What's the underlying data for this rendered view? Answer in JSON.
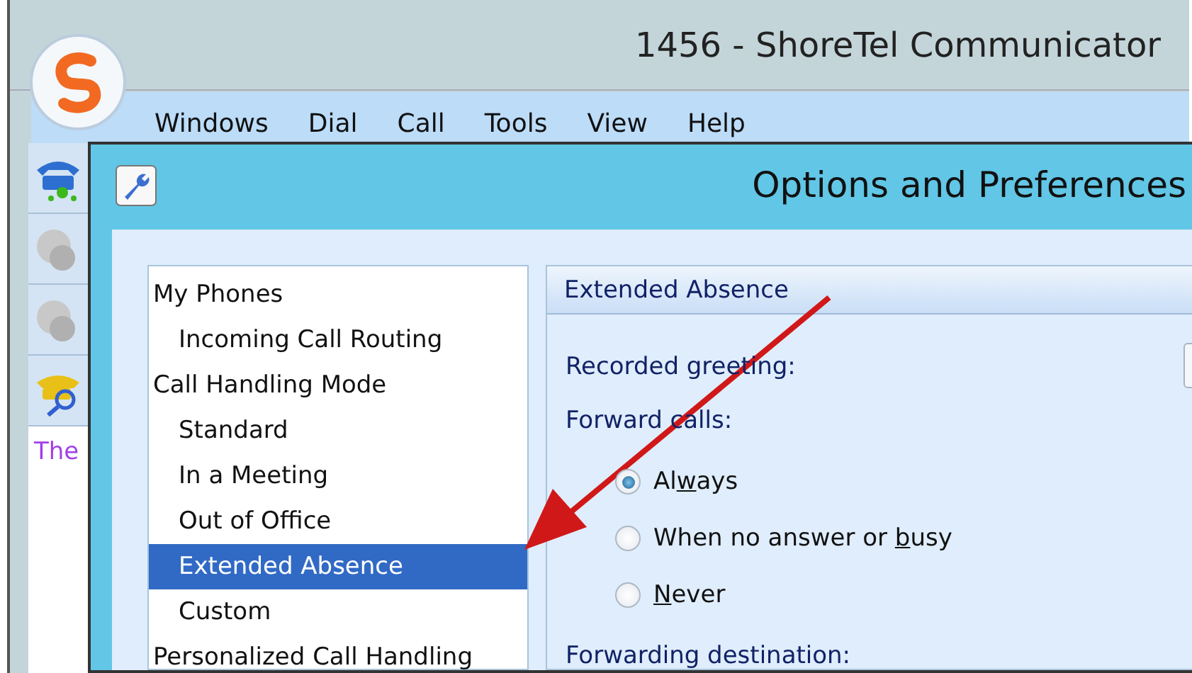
{
  "main_window": {
    "title": "1456 - ShoreTel Communicator",
    "menu": [
      "Windows",
      "Dial",
      "Call",
      "Tools",
      "View",
      "Help"
    ],
    "sidebar_text": "The"
  },
  "dialog": {
    "title": "Options and Preferences",
    "tree": [
      {
        "label": "My Phones",
        "selected": false,
        "children": [
          {
            "label": "Incoming Call Routing",
            "selected": false
          }
        ]
      },
      {
        "label": "Call Handling Mode",
        "selected": false,
        "children": [
          {
            "label": "Standard",
            "selected": false
          },
          {
            "label": "In a Meeting",
            "selected": false
          },
          {
            "label": "Out of Office",
            "selected": false
          },
          {
            "label": "Extended Absence",
            "selected": true
          },
          {
            "label": "Custom",
            "selected": false
          }
        ]
      },
      {
        "label": "Personalized Call Handling",
        "selected": false
      }
    ],
    "panel": {
      "header": "Extended Absence",
      "greeting_label": "Recorded greeting:",
      "forward_label": "Forward calls:",
      "options": [
        {
          "label_before": "Al",
          "access_key": "w",
          "label_after": "ays",
          "selected": true
        },
        {
          "label_before": "When no answer or ",
          "access_key": "b",
          "label_after": "usy",
          "selected": false
        },
        {
          "access_key": "N",
          "label_after": "ever",
          "selected": false
        }
      ],
      "destination_label": "Forwarding destination:"
    }
  }
}
